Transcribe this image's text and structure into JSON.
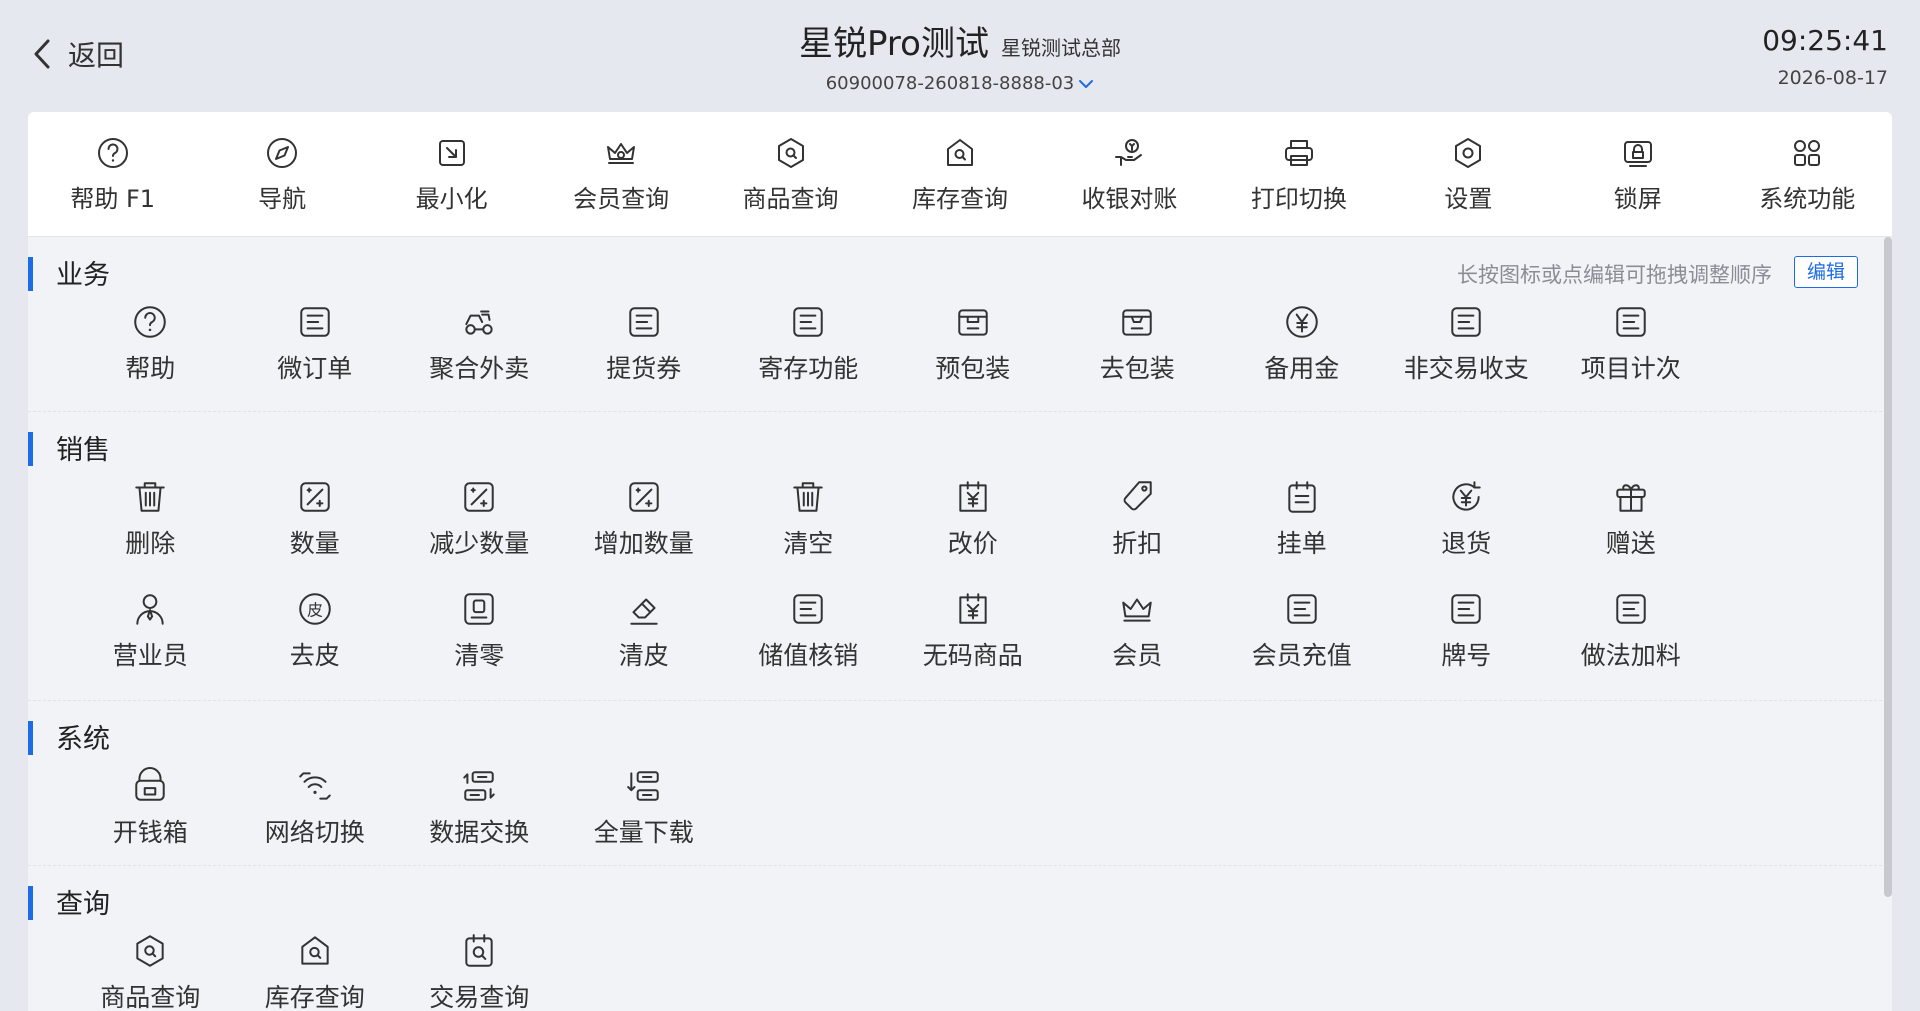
{
  "header": {
    "back_label": "返回",
    "store_name": "星锐Pro测试",
    "store_sub": "星锐测试总部",
    "device_id": "60900078-260818-8888-03",
    "time": "09:25:41",
    "date": "2026-08-17"
  },
  "toolbar": [
    {
      "label": "帮助 F1",
      "icon": "help-icon"
    },
    {
      "label": "导航",
      "icon": "compass-icon"
    },
    {
      "label": "最小化",
      "icon": "minimize-icon"
    },
    {
      "label": "会员查询",
      "icon": "crown-search-icon"
    },
    {
      "label": "商品查询",
      "icon": "product-search-icon"
    },
    {
      "label": "库存查询",
      "icon": "stock-search-icon"
    },
    {
      "label": "收银对账",
      "icon": "reconcile-icon"
    },
    {
      "label": "打印切换",
      "icon": "printer-icon"
    },
    {
      "label": "设置",
      "icon": "settings-icon"
    },
    {
      "label": "锁屏",
      "icon": "lock-screen-icon"
    },
    {
      "label": "系统功能",
      "icon": "apps-grid-icon"
    }
  ],
  "sections": {
    "business": {
      "title": "业务",
      "hint": "长按图标或点编辑可拖拽调整顺序",
      "edit_label": "编辑",
      "items": [
        {
          "label": "帮助",
          "icon": "help-icon"
        },
        {
          "label": "微订单",
          "icon": "doc-list-icon"
        },
        {
          "label": "聚合外卖",
          "icon": "delivery-icon"
        },
        {
          "label": "提货券",
          "icon": "doc-list-icon"
        },
        {
          "label": "寄存功能",
          "icon": "doc-list-icon"
        },
        {
          "label": "预包装",
          "icon": "package-icon"
        },
        {
          "label": "去包装",
          "icon": "unpackage-icon"
        },
        {
          "label": "备用金",
          "icon": "yen-circle-icon"
        },
        {
          "label": "非交易收支",
          "icon": "doc-list-icon"
        },
        {
          "label": "项目计次",
          "icon": "doc-list-icon"
        }
      ]
    },
    "sales": {
      "title": "销售",
      "items": [
        {
          "label": "删除",
          "icon": "trash-icon"
        },
        {
          "label": "数量",
          "icon": "quantity-icon"
        },
        {
          "label": "减少数量",
          "icon": "quantity-icon"
        },
        {
          "label": "增加数量",
          "icon": "quantity-icon"
        },
        {
          "label": "清空",
          "icon": "trash-icon"
        },
        {
          "label": "改价",
          "icon": "price-change-icon"
        },
        {
          "label": "折扣",
          "icon": "tag-icon"
        },
        {
          "label": "挂单",
          "icon": "clipboard-icon"
        },
        {
          "label": "退货",
          "icon": "refund-icon"
        },
        {
          "label": "赠送",
          "icon": "gift-icon"
        },
        {
          "label": "营业员",
          "icon": "clerk-icon"
        },
        {
          "label": "去皮",
          "icon": "peel-icon"
        },
        {
          "label": "清零",
          "icon": "zero-icon"
        },
        {
          "label": "清皮",
          "icon": "eraser-icon"
        },
        {
          "label": "储值核销",
          "icon": "doc-list-icon"
        },
        {
          "label": "无码商品",
          "icon": "price-change-icon"
        },
        {
          "label": "会员",
          "icon": "crown-icon"
        },
        {
          "label": "会员充值",
          "icon": "doc-list-icon"
        },
        {
          "label": "牌号",
          "icon": "doc-list-icon"
        },
        {
          "label": "做法加料",
          "icon": "doc-list-icon"
        }
      ]
    },
    "system": {
      "title": "系统",
      "items": [
        {
          "label": "开钱箱",
          "icon": "cash-drawer-icon"
        },
        {
          "label": "网络切换",
          "icon": "wifi-switch-icon"
        },
        {
          "label": "数据交换",
          "icon": "data-exchange-icon"
        },
        {
          "label": "全量下载",
          "icon": "download-all-icon"
        }
      ]
    },
    "query": {
      "title": "查询",
      "items": [
        {
          "label": "商品查询",
          "icon": "product-search-icon"
        },
        {
          "label": "库存查询",
          "icon": "stock-search-icon"
        },
        {
          "label": "交易查询",
          "icon": "transaction-search-icon"
        }
      ]
    }
  },
  "colors": {
    "accent": "#1d6ce6",
    "background": "#e6e8ef",
    "panel": "#ffffff",
    "content": "#f2f3f6"
  }
}
